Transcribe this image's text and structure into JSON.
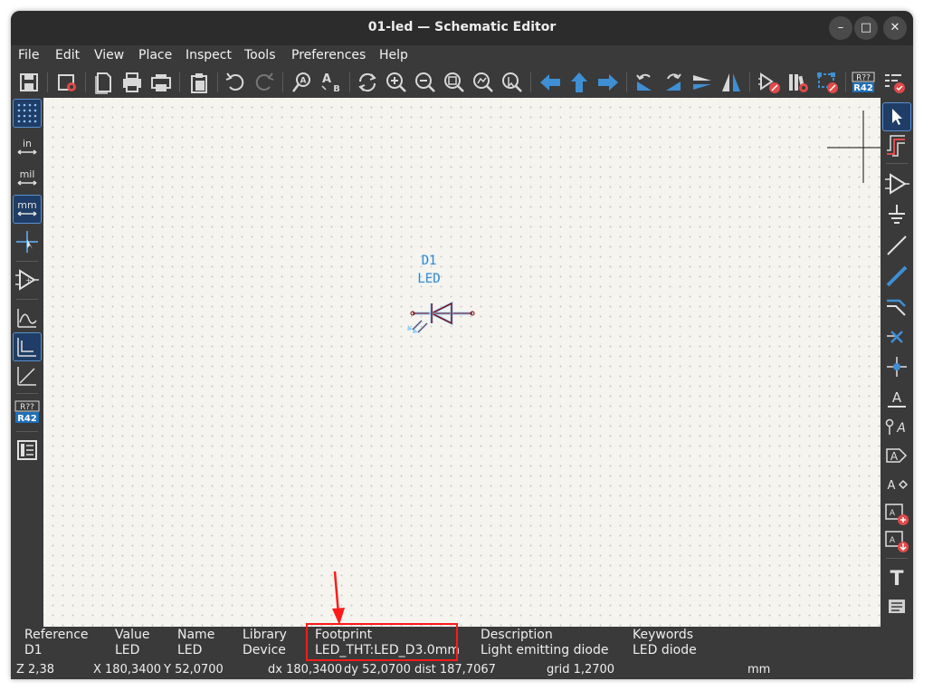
{
  "window": {
    "title": "01-led — Schematic Editor"
  },
  "window_controls": {
    "minimize": "–",
    "maximize": "□",
    "close": "✕"
  },
  "menu": [
    "File",
    "Edit",
    "View",
    "Place",
    "Inspect",
    "Tools",
    "Preferences",
    "Help"
  ],
  "toolbar_top": {
    "icons": [
      "save-icon",
      "schematic-setup-icon",
      "page-settings-icon",
      "print-icon",
      "plot-icon",
      "paste-icon",
      "undo-icon",
      "redo-icon",
      "find-icon",
      "find-replace-icon",
      "refresh-icon",
      "zoom-in-icon",
      "zoom-out-icon",
      "zoom-fit-icon",
      "zoom-objects-icon",
      "zoom-selection-icon",
      "navigate-back-icon",
      "navigate-up-icon",
      "navigate-forward-icon",
      "rotate-ccw-icon",
      "rotate-cw-icon",
      "mirror-vertical-icon",
      "mirror-horizontal-icon",
      "symbol-editor-icon",
      "symbol-library-browser-icon",
      "footprint-assignment-icon",
      "annotate-icon",
      "erc-icon"
    ],
    "annotate_badge": {
      "top": "R??",
      "bottom": "R42"
    }
  },
  "toolbar_left": {
    "units": {
      "in": "in",
      "mil": "mil",
      "mm": "mm"
    },
    "annotate_badge": {
      "top": "R??",
      "bottom": "R42"
    }
  },
  "toolbar_right": {
    "text_tool": "T",
    "label_tool": "A",
    "net_label": "A",
    "global_label": "A",
    "pin_label": "A",
    "sheet_pin": "A",
    "import_sheet_pin": "A",
    "rule_area": "A"
  },
  "schematic": {
    "component": {
      "reference": "D1",
      "value": "LED"
    }
  },
  "info_panel": {
    "columns": [
      {
        "header": "Reference",
        "value": "D1"
      },
      {
        "header": "Value",
        "value": "LED"
      },
      {
        "header": "Name",
        "value": "LED"
      },
      {
        "header": "Library",
        "value": "Device"
      },
      {
        "header": "Footprint",
        "value": "LED_THT:LED_D3.0mm"
      },
      {
        "header": "Description",
        "value": "Light emitting diode"
      },
      {
        "header": "Keywords",
        "value": "LED diode"
      }
    ]
  },
  "status_bar": {
    "zoom": "Z 2,38",
    "x": "X 180,3400",
    "y": "Y 52,0700",
    "dx": "dx 180,3400",
    "dy": "dy 52,0700",
    "dist": "dist 187,7067",
    "grid": "grid 1,2700",
    "units": "mm"
  },
  "colors": {
    "canvas_bg": "#f5f4ef",
    "ui_bg": "#3a3a3a",
    "symbol_body": "#840000",
    "selection_highlight": "#6fb6ff",
    "annotation_red": "#ff1a1a",
    "toolbar_blue": "#2f8fd8"
  }
}
